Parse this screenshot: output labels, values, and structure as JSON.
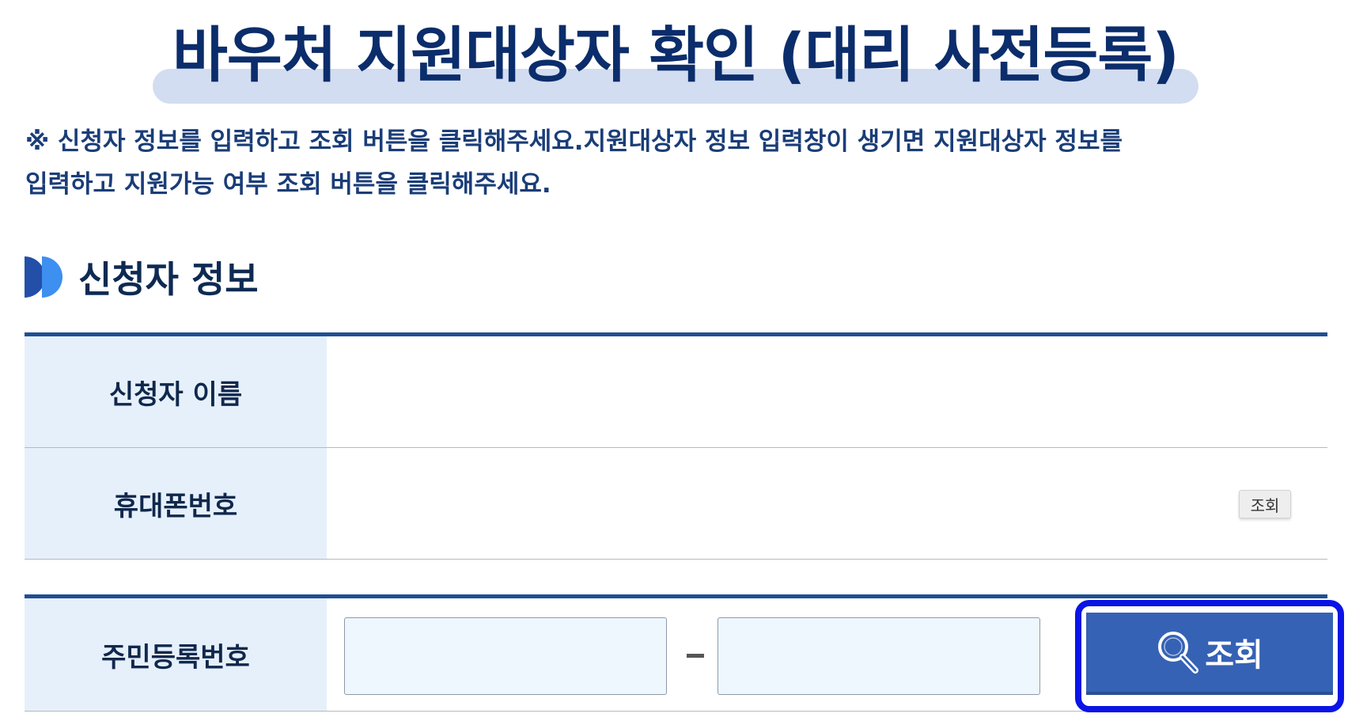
{
  "title": "바우처 지원대상자 확인 (대리 사전등록)",
  "notice": {
    "line1": "※ 신청자 정보를 입력하고 조회 버튼을 클릭해주세요.지원대상자 정보 입력창이 생기면 지원대상자 정보를",
    "line2": "입력하고 지원가능 여부 조회 버튼을 클릭해주세요."
  },
  "section": {
    "title": "신청자 정보",
    "icon": "double-half-circle-icon"
  },
  "rows": {
    "name_label": "신청자 이름",
    "name_value": "",
    "phone_label": "휴대폰번호",
    "phone_value": "",
    "phone_query_label": "조회",
    "ssn_label": "주민등록번호",
    "ssn_front": "",
    "ssn_back": "",
    "ssn_query_label": "조회",
    "ssn_query_icon": "magnifier-icon"
  },
  "colors": {
    "title_text": "#0b2d6b",
    "title_highlight": "#d3ddf1",
    "table_border": "#1f4f92",
    "label_bg": "#e6f0fb",
    "query_button_bg": "#3562b5",
    "focus_outline": "#0a14e6"
  }
}
